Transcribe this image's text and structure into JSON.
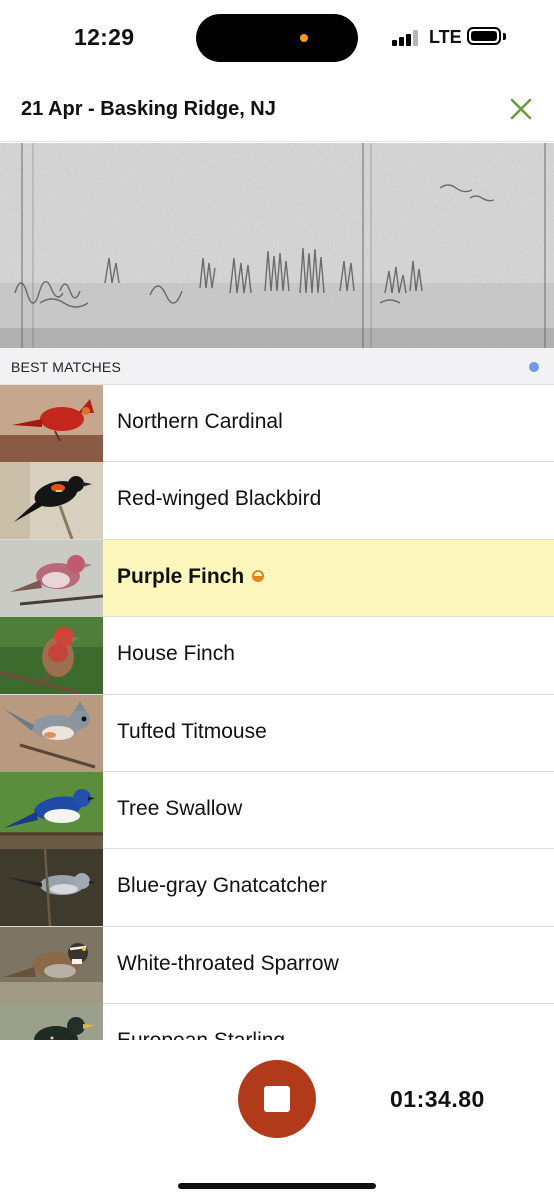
{
  "status_bar": {
    "time": "12:29",
    "network": "LTE",
    "recording_indicator_color": "#f29a22"
  },
  "header": {
    "title": "21 Apr - Basking Ridge, NJ",
    "close_icon": "close-x-icon",
    "accent_color": "#6b9a3c"
  },
  "matches": {
    "section_title": "BEST MATCHES",
    "indicator_color": "#6d9ae0",
    "highlight_color": "#fdf7bd",
    "items": [
      {
        "name": "Northern Cardinal",
        "thumbnail": "northern-cardinal-photo"
      },
      {
        "name": "Red-winged Blackbird",
        "thumbnail": "red-winged-blackbird-photo"
      },
      {
        "name": "Purple Finch",
        "thumbnail": "purple-finch-photo",
        "highlighted": true,
        "badge_icon": "possible-match-icon"
      },
      {
        "name": "House Finch",
        "thumbnail": "house-finch-photo"
      },
      {
        "name": "Tufted Titmouse",
        "thumbnail": "tufted-titmouse-photo"
      },
      {
        "name": "Tree Swallow",
        "thumbnail": "tree-swallow-photo"
      },
      {
        "name": "Blue-gray Gnatcatcher",
        "thumbnail": "blue-gray-gnatcatcher-photo"
      },
      {
        "name": "White-throated Sparrow",
        "thumbnail": "white-throated-sparrow-photo"
      },
      {
        "name": "European Starling",
        "thumbnail": "european-starling-photo"
      }
    ]
  },
  "recording": {
    "stop_icon": "stop-icon",
    "stop_color": "#b13a1a",
    "elapsed": "01:34.80"
  }
}
